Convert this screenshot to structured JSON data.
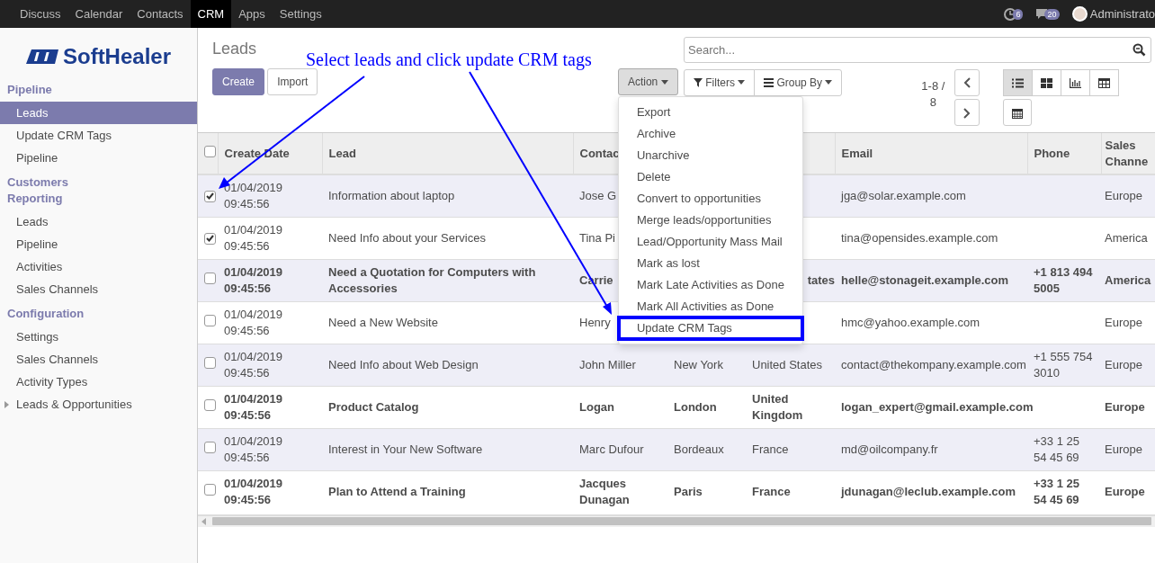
{
  "top_menu": [
    {
      "label": "Discuss",
      "selected": false
    },
    {
      "label": "Calendar",
      "selected": false
    },
    {
      "label": "Contacts",
      "selected": false
    },
    {
      "label": "CRM",
      "selected": true
    },
    {
      "label": "Apps",
      "selected": false
    },
    {
      "label": "Settings",
      "selected": false
    }
  ],
  "systray": {
    "activity_count": "6",
    "message_count": "20",
    "user": "Administrato"
  },
  "sidebar": {
    "logo": "SoftHealer",
    "sections": [
      {
        "title": "Pipeline",
        "items": [
          {
            "label": "Leads",
            "selected": true,
            "kind": "link"
          },
          {
            "label": "Update CRM Tags",
            "selected": false,
            "kind": "link"
          },
          {
            "label": "Pipeline",
            "selected": false,
            "kind": "link"
          }
        ]
      },
      {
        "title": "Customers Reporting",
        "items": [
          {
            "label": "Leads",
            "selected": false,
            "kind": "link"
          },
          {
            "label": "Pipeline",
            "selected": false,
            "kind": "link"
          },
          {
            "label": "Activities",
            "selected": false,
            "kind": "link"
          },
          {
            "label": "Sales Channels",
            "selected": false,
            "kind": "link"
          }
        ]
      },
      {
        "title": "Configuration",
        "items": [
          {
            "label": "Settings",
            "selected": false,
            "kind": "link"
          },
          {
            "label": "Sales Channels",
            "selected": false,
            "kind": "link"
          },
          {
            "label": "Activity Types",
            "selected": false,
            "kind": "link"
          },
          {
            "label": "Leads & Opportunities",
            "selected": false,
            "kind": "folder",
            "expanded": false
          }
        ]
      }
    ]
  },
  "control_panel": {
    "breadcrumb": "Leads",
    "buttons": [
      {
        "label": "Create",
        "kind": "primary"
      },
      {
        "label": "Import",
        "kind": "secondary"
      }
    ],
    "action": {
      "label": "Action",
      "open": true,
      "items": [
        {
          "label": "Export",
          "highlighted": false
        },
        {
          "label": "Archive",
          "highlighted": false
        },
        {
          "label": "Unarchive",
          "highlighted": false
        },
        {
          "label": "Delete",
          "highlighted": false
        },
        {
          "label": "Convert to opportunities",
          "highlighted": false
        },
        {
          "label": "Merge leads/opportunities",
          "highlighted": false
        },
        {
          "label": "Lead/Opportunity Mass Mail",
          "highlighted": false
        },
        {
          "label": "Mark as lost",
          "highlighted": false
        },
        {
          "label": "Mark Late Activities as Done",
          "highlighted": false
        },
        {
          "label": "Mark All Activities as Done",
          "highlighted": false
        },
        {
          "label": "Update CRM Tags",
          "highlighted": true
        }
      ]
    },
    "search": {
      "placeholder": "Search..."
    },
    "filters": "Filters",
    "group_by": "Group By",
    "pager": "1-8 / 8",
    "views": [
      {
        "kind": "list",
        "selected": true
      },
      {
        "kind": "kanban",
        "selected": false
      },
      {
        "kind": "graph",
        "selected": false
      },
      {
        "kind": "pivot",
        "selected": false
      },
      {
        "kind": "calendar",
        "selected": false
      }
    ]
  },
  "annotation": {
    "text": "Select leads and click update CRM tags"
  },
  "table": {
    "all_selected": false,
    "columns": {
      "create_date": "Create Date",
      "lead": "Lead",
      "contact": "Contac",
      "email": "Email",
      "phone": "Phone",
      "sales_channel": "Sales Channe"
    },
    "rows": [
      {
        "selected": true,
        "unread": false,
        "create_date": "01/04/2019 09:45:56",
        "lead": "Information about laptop",
        "contact": "Jose G",
        "email": "jga@solar.example.com",
        "sales_channel": "Europe"
      },
      {
        "selected": true,
        "unread": false,
        "create_date": "01/04/2019 09:45:56",
        "lead": "Need Info about your Services",
        "contact": "Tina Pi",
        "email": "tina@opensides.example.com",
        "sales_channel": "America"
      },
      {
        "selected": false,
        "unread": true,
        "create_date": "01/04/2019 09:45:56",
        "lead": "Need a Quotation for Computers with Accessories",
        "contact": "Carrie",
        "column_5": "tates",
        "email": "helle@stonageit.example.com",
        "phone": "+1 813 494 5005",
        "sales_channel": "America"
      },
      {
        "selected": false,
        "unread": false,
        "create_date": "01/04/2019 09:45:56",
        "lead": "Need a New Website",
        "contact": "Henry",
        "email": "hmc@yahoo.example.com",
        "sales_channel": "Europe"
      },
      {
        "selected": false,
        "unread": false,
        "create_date": "01/04/2019 09:45:56",
        "lead": "Need Info about Web Design",
        "contact": "John Miller",
        "column_4": "New York",
        "column_5": "United States",
        "email": "contact@thekompany.example.com",
        "phone": "+1 555 754 3010",
        "sales_channel": "Europe"
      },
      {
        "selected": false,
        "unread": true,
        "create_date": "01/04/2019 09:45:56",
        "lead": "Product Catalog",
        "contact": "Logan",
        "column_4": "London",
        "column_5": "United Kingdom",
        "email": "logan_expert@gmail.example.com",
        "sales_channel": "Europe"
      },
      {
        "selected": false,
        "unread": false,
        "create_date": "01/04/2019 09:45:56",
        "lead": "Interest in Your New Software",
        "contact": "Marc Dufour",
        "column_4": "Bordeaux",
        "column_5": "France",
        "email": "md@oilcompany.fr",
        "phone": "+33 1 25 54 45 69",
        "sales_channel": "Europe"
      },
      {
        "selected": false,
        "unread": true,
        "create_date": "01/04/2019 09:45:56",
        "lead": "Plan to Attend a Training",
        "contact": "Jacques Dunagan",
        "column_4": "Paris",
        "column_5": "France",
        "email": "jdunagan@leclub.example.com",
        "phone": "+33 1 25 54 45 69",
        "sales_channel": "Europe"
      }
    ]
  }
}
